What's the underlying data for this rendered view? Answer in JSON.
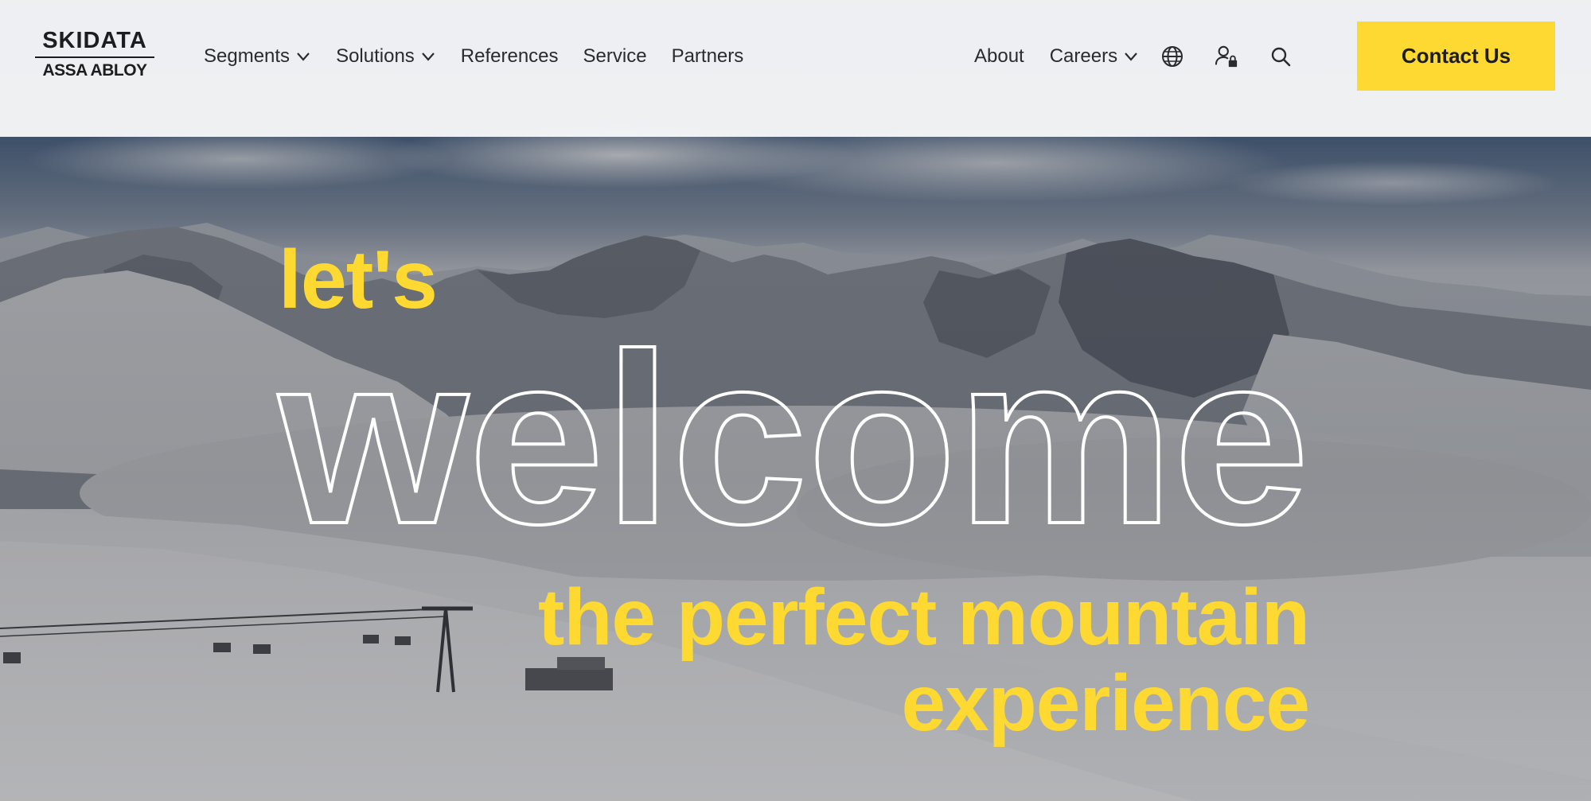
{
  "brand": {
    "logo_top": "SKIDATA",
    "logo_bottom": "ASSA ABLOY",
    "accent_color": "#fed931"
  },
  "nav": {
    "left_items": [
      {
        "label": "Segments",
        "has_dropdown": true
      },
      {
        "label": "Solutions",
        "has_dropdown": true
      },
      {
        "label": "References",
        "has_dropdown": false
      },
      {
        "label": "Service",
        "has_dropdown": false
      },
      {
        "label": "Partners",
        "has_dropdown": false
      }
    ],
    "right_items": [
      {
        "label": "About",
        "has_dropdown": false
      },
      {
        "label": "Careers",
        "has_dropdown": true
      }
    ],
    "icons": [
      "globe-icon",
      "user-lock-icon",
      "search-icon"
    ],
    "contact_label": "Contact Us"
  },
  "hero": {
    "line1": "let's",
    "line2": "welcome",
    "line3": "the perfect mountain",
    "line4": "experience"
  }
}
